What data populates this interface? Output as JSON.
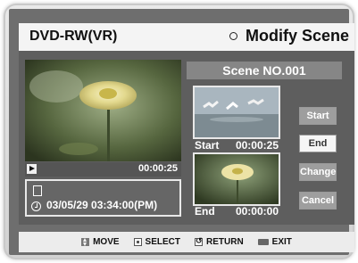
{
  "header": {
    "left_title": "DVD-RW(VR)",
    "right_title": "Modify Scene"
  },
  "playback": {
    "time": "00:00:25",
    "datetime": "03/05/29 03:34:00(PM)"
  },
  "scene": {
    "title": "Scene NO.001",
    "start_label": "Start",
    "start_time": "00:00:25",
    "end_label": "End",
    "end_time": "00:00:00"
  },
  "buttons": {
    "start": "Start",
    "end": "End",
    "change": "Change",
    "cancel": "Cancel"
  },
  "footer": {
    "move": "MOVE",
    "select": "SELECT",
    "return": "RETURN",
    "exit": "EXIT"
  },
  "colors": {
    "panel": "#5e5e5e",
    "active_button": "#f6f6f6",
    "inactive_button": "#9e9e9e"
  }
}
